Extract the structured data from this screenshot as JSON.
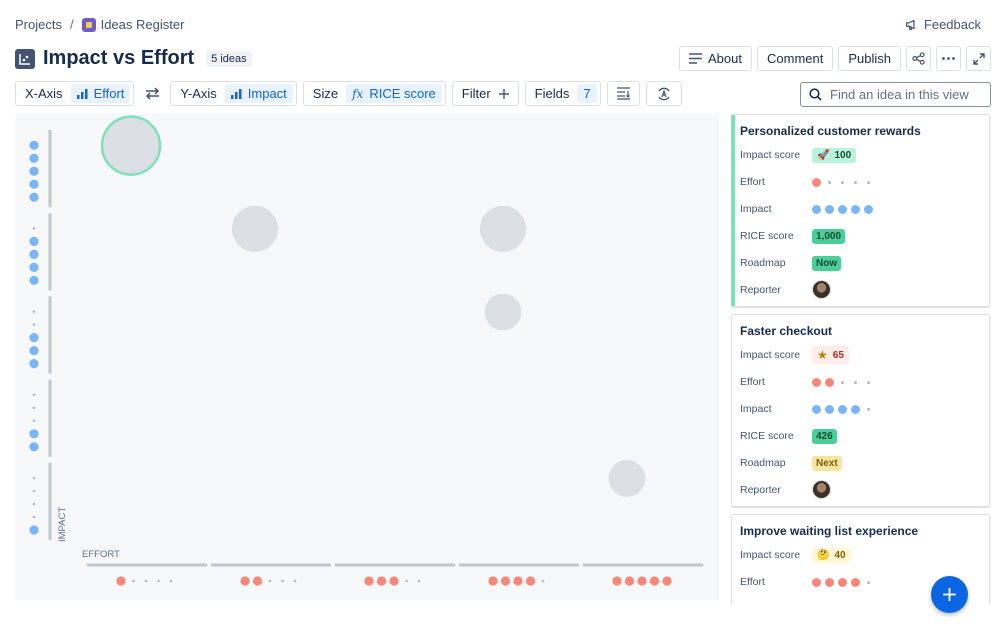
{
  "breadcrumb": {
    "projects": "Projects",
    "separator": "/",
    "project_name": "Ideas Register"
  },
  "feedback_label": "Feedback",
  "page": {
    "title": "Impact vs Effort",
    "count": "5 ideas"
  },
  "top_actions": {
    "about": "About",
    "comment": "Comment",
    "publish": "Publish"
  },
  "toolbar": {
    "x_axis_label": "X-Axis",
    "x_axis_value": "Effort",
    "y_axis_label": "Y-Axis",
    "y_axis_value": "Impact",
    "size_label": "Size",
    "size_value": "RICE score",
    "filter_label": "Filter",
    "fields_label": "Fields",
    "fields_count": "7"
  },
  "search": {
    "placeholder": "Find an idea in this view"
  },
  "colors": {
    "effort": "#f8877a",
    "impact": "#7ab6f7",
    "selected_bubble": "#7ee2b8",
    "bubble": "#dcdfe4",
    "accent": "#0c66e4"
  },
  "chart_data": {
    "type": "scatter",
    "xlabel": "EFFORT",
    "ylabel": "IMPACT",
    "x_levels": [
      1,
      2,
      3,
      4,
      5
    ],
    "y_levels": [
      1,
      2,
      3,
      4,
      5
    ],
    "points": [
      {
        "x": 1,
        "y": 5,
        "size": 1000,
        "selected": true
      },
      {
        "x": 2,
        "y": 4,
        "size": 426
      },
      {
        "x": 4,
        "y": 4,
        "size": 426
      },
      {
        "x": 4,
        "y": 3,
        "size": 140
      },
      {
        "x": 5,
        "y": 1,
        "size": 140
      }
    ]
  },
  "cards": [
    {
      "title": "Personalized customer rewards",
      "selected": true,
      "impact_score_label": "Impact score",
      "impact_score_icon": "rocket-icon",
      "impact_score": "100",
      "effort_label": "Effort",
      "effort": 1,
      "impact_label": "Impact",
      "impact": 5,
      "rice_label": "RICE score",
      "rice": "1,000",
      "roadmap_label": "Roadmap",
      "roadmap": "Now",
      "reporter_label": "Reporter"
    },
    {
      "title": "Faster checkout",
      "selected": false,
      "impact_score_label": "Impact score",
      "impact_score_icon": "star-icon",
      "impact_score": "65",
      "effort_label": "Effort",
      "effort": 2,
      "impact_label": "Impact",
      "impact": 4,
      "rice_label": "RICE score",
      "rice": "426",
      "roadmap_label": "Roadmap",
      "roadmap": "Next",
      "reporter_label": "Reporter"
    },
    {
      "title": "Improve waiting list experience",
      "selected": false,
      "impact_score_label": "Impact score",
      "impact_score_icon": "thinking-face-icon",
      "impact_score": "40",
      "effort_label": "Effort",
      "effort": 4
    }
  ]
}
